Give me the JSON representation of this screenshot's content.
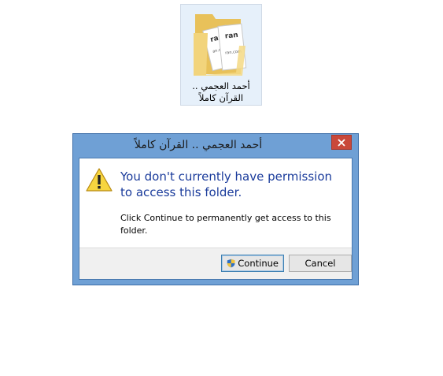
{
  "folder": {
    "label_line1": "أحمد العجمي ..",
    "label_line2": "القرآن كاملاً",
    "icon": "folder-icon"
  },
  "dialog": {
    "title": "أحمد العجمي .. القرآن كاملاً",
    "close_icon": "close-icon",
    "warning_icon": "warning-icon",
    "main_instruction": "You don't currently have permission to access this folder.",
    "content": "Click Continue to permanently get access to this folder.",
    "buttons": {
      "continue_label": "Continue",
      "continue_icon": "uac-shield-icon",
      "cancel_label": "Cancel"
    }
  },
  "colors": {
    "title_bar": "#6fa0d5",
    "close_button": "#c9483a",
    "main_instruction_text": "#1a3b9b",
    "folder_tile_bg": "#e6f0fa"
  }
}
